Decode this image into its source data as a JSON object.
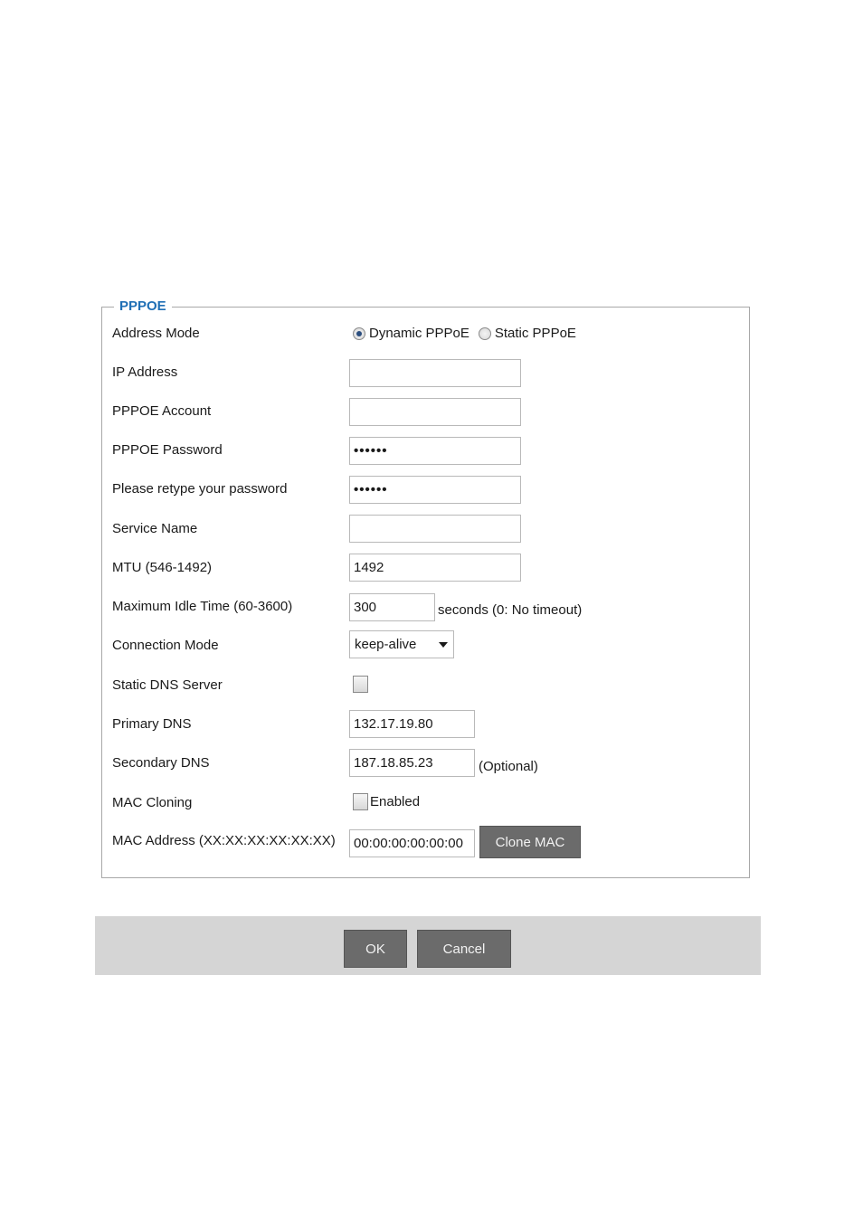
{
  "section": {
    "legend": "PPPOE"
  },
  "fields": {
    "address_mode": {
      "label": "Address Mode",
      "option_dynamic": "Dynamic PPPoE",
      "option_static": "Static PPPoE",
      "selected": "Dynamic PPPoE"
    },
    "ip_address": {
      "label": "IP Address",
      "value": ""
    },
    "account": {
      "label": "PPPOE Account",
      "value": ""
    },
    "password": {
      "label": "PPPOE Password",
      "value": "••••••"
    },
    "retype_password": {
      "label": "Please retype your password",
      "value": "••••••"
    },
    "service_name": {
      "label": "Service Name",
      "value": ""
    },
    "mtu": {
      "label": "MTU (546-1492)",
      "value": "1492"
    },
    "idle_time": {
      "label": "Maximum Idle Time (60-3600)",
      "value": "300",
      "suffix": "seconds (0: No timeout)"
    },
    "connection_mode": {
      "label": "Connection Mode",
      "value": "keep-alive"
    },
    "static_dns": {
      "label": "Static DNS Server",
      "checked": false
    },
    "primary_dns": {
      "label": "Primary DNS",
      "value": "132.17.19.80"
    },
    "secondary_dns": {
      "label": "Secondary DNS",
      "value": "187.18.85.23",
      "suffix": "(Optional)"
    },
    "mac_cloning": {
      "label": "MAC Cloning",
      "checkbox_label": "Enabled",
      "checked": false
    },
    "mac_address": {
      "label": "MAC Address (XX:XX:XX:XX:XX:XX)",
      "value": "00:00:00:00:00:00",
      "clone_button": "Clone MAC"
    }
  },
  "footer": {
    "ok": "OK",
    "cancel": "Cancel"
  }
}
